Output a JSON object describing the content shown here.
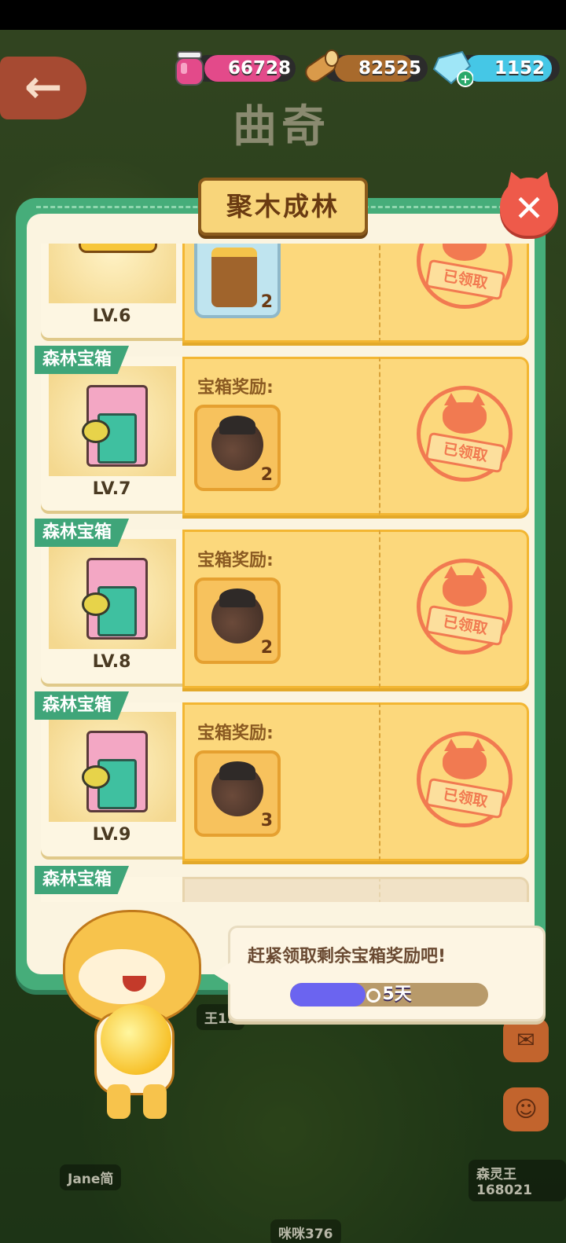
{
  "resources": {
    "jam": {
      "value": "66728",
      "icon": "jam-jar-icon",
      "color": "#e34a8a"
    },
    "wood": {
      "value": "82525",
      "icon": "wood-log-icon",
      "color": "#a86a2c"
    },
    "gem": {
      "value": "1152",
      "icon": "diamond-icon",
      "color": "#45c7e6"
    }
  },
  "town": {
    "name": "曲奇"
  },
  "panel": {
    "title": "聚木成林"
  },
  "rows": [
    {
      "tag": "",
      "level": "LV.6",
      "reward_label": "",
      "count": "2",
      "stamp": "已领取"
    },
    {
      "tag": "森林宝箱",
      "level": "LV.7",
      "reward_label": "宝箱奖励:",
      "count": "2",
      "stamp": "已领取"
    },
    {
      "tag": "森林宝箱",
      "level": "LV.8",
      "reward_label": "宝箱奖励:",
      "count": "2",
      "stamp": "已领取"
    },
    {
      "tag": "森林宝箱",
      "level": "LV.9",
      "reward_label": "宝箱奖励:",
      "count": "3",
      "stamp": "已领取"
    },
    {
      "tag": "森林宝箱"
    }
  ],
  "helper": {
    "message": "赶紧领取剩余宝箱奖励吧!",
    "timer": "5天",
    "timer_progress": 0.38
  },
  "background": {
    "name_left": "Jane简",
    "name_right": "森灵王168021",
    "name_mid": "王12",
    "name_bottom": "咪咪376"
  }
}
